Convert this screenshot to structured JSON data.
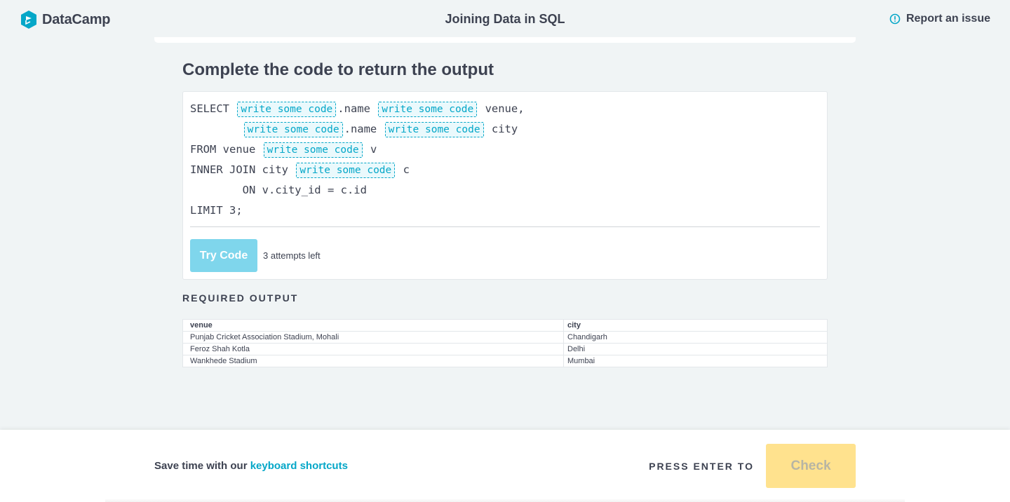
{
  "header": {
    "logo_text": "DataCamp",
    "course_title": "Joining Data in SQL",
    "report_label": "Report an issue"
  },
  "exercise": {
    "title": "Complete the code to return the output",
    "blank_placeholder": "write some code",
    "code_lines": [
      [
        "SELECT ",
        "__",
        ".name ",
        "__",
        " venue,"
      ],
      [
        "        ",
        "__",
        ".name ",
        "__",
        " city"
      ],
      [
        "FROM venue ",
        "__",
        " v"
      ],
      [
        "INNER JOIN city ",
        "__",
        " c"
      ],
      [
        "        ON v.city_id = c.id"
      ],
      [
        "LIMIT 3;"
      ]
    ],
    "try_button": "Try Code",
    "attempts": "3 attempts left"
  },
  "required_output": {
    "label": "REQUIRED OUTPUT",
    "columns": [
      "venue",
      "city"
    ],
    "rows": [
      [
        "Punjab Cricket Association Stadium, Mohali",
        "Chandigarh"
      ],
      [
        "Feroz Shah Kotla",
        "Delhi"
      ],
      [
        "Wankhede Stadium",
        "Mumbai"
      ]
    ]
  },
  "footer": {
    "hint_prefix": "Save time with our ",
    "hint_link": "keyboard shortcuts",
    "press_enter": "PRESS ENTER TO",
    "check_button": "Check"
  },
  "colors": {
    "accent": "#05a7c8",
    "try_button": "#7fd6ec",
    "check_button": "#ffe28e",
    "background": "#f0f4f5"
  }
}
